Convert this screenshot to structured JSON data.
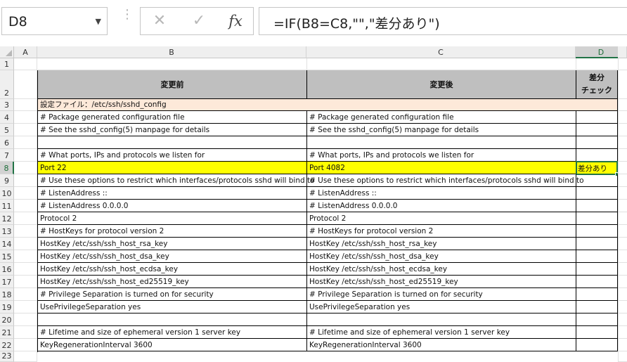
{
  "formula_bar": {
    "name_box": "D8",
    "name_box_arrow_icon": "chevron-down-icon",
    "cancel_icon": "close-icon",
    "enter_icon": "checkmark-icon",
    "fx_label": "fx",
    "formula": "=IF(B8=C8,\"\",\"差分あり\")"
  },
  "grid": {
    "columns": [
      "A",
      "B",
      "C",
      "D"
    ],
    "selected_column": "D",
    "selected_row": "8",
    "rows": [
      "1",
      "2",
      "3",
      "4",
      "5",
      "6",
      "7",
      "8",
      "9",
      "10",
      "11",
      "12",
      "13",
      "14",
      "15",
      "16",
      "17",
      "18",
      "19",
      "20",
      "21",
      "22",
      "23"
    ],
    "header": {
      "before": "変更前",
      "after": "変更後",
      "check_line1": "差分",
      "check_line2": "チェック"
    },
    "file_label": "設定ファイル：/etc/ssh/sshd_config",
    "before_lines": [
      "# Package generated configuration file",
      "# See the sshd_config(5) manpage for details",
      "",
      "# What ports, IPs and protocols we listen for",
      "Port 22",
      "# Use these options to restrict which interfaces/protocols sshd will bind to",
      "# ListenAddress ::",
      "# ListenAddress 0.0.0.0",
      "Protocol 2",
      "# HostKeys for protocol version 2",
      "HostKey /etc/ssh/ssh_host_rsa_key",
      "HostKey /etc/ssh/ssh_host_dsa_key",
      "HostKey /etc/ssh/ssh_host_ecdsa_key",
      "HostKey /etc/ssh/ssh_host_ed25519_key",
      "# Privilege Separation is turned on for security",
      "UsePrivilegeSeparation yes",
      "",
      "# Lifetime and size of ephemeral version 1 server key",
      "KeyRegenerationInterval 3600"
    ],
    "after_lines": [
      "# Package generated configuration file",
      "# See the sshd_config(5) manpage for details",
      "",
      "# What ports, IPs and protocols we listen for",
      "Port 4082",
      "# Use these options to restrict which interfaces/protocols sshd will bind to",
      "# ListenAddress ::",
      "# ListenAddress 0.0.0.0",
      "Protocol 2",
      "# HostKeys for protocol version 2",
      "HostKey /etc/ssh/ssh_host_rsa_key",
      "HostKey /etc/ssh/ssh_host_dsa_key",
      "HostKey /etc/ssh/ssh_host_ecdsa_key",
      "HostKey /etc/ssh/ssh_host_ed25519_key",
      "# Privilege Separation is turned on for security",
      "UsePrivilegeSeparation yes",
      "",
      "# Lifetime and size of ephemeral version 1 server key",
      "KeyRegenerationInterval 3600"
    ],
    "check_values": [
      "",
      "",
      "",
      "",
      "差分あり",
      "",
      "",
      "",
      "",
      "",
      "",
      "",
      "",
      "",
      "",
      "",
      "",
      "",
      ""
    ],
    "highlight_row": "8",
    "colors": {
      "header_fill": "#bfbfbf",
      "file_row_fill": "#fde9d9",
      "diff_fill": "#ffff00",
      "selection": "#217346"
    }
  }
}
